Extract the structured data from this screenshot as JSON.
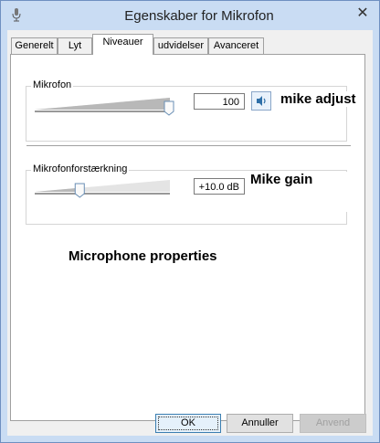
{
  "window": {
    "title": "Egenskaber for Mikrofon",
    "close_glyph": "✕",
    "icon": "microphone-icon"
  },
  "tabs": [
    {
      "label": "Generelt",
      "active": false
    },
    {
      "label": "Lyt",
      "active": false
    },
    {
      "label": "Niveauer",
      "active": true
    },
    {
      "label": "udvidelser",
      "active": false
    },
    {
      "label": "Avanceret",
      "active": false
    }
  ],
  "microphone_group": {
    "label": "Mikrofon",
    "slider_level": 1.0,
    "value": "100",
    "mute_icon": "speaker-icon",
    "annotation": "mike adjust"
  },
  "boost_group": {
    "label": "Mikrofonforstærkning",
    "slider_level": 0.333,
    "value": "+10.0 dB",
    "annotation": "Mike gain"
  },
  "caption": "Microphone properties",
  "buttons": {
    "ok": "OK",
    "cancel": "Annuller",
    "apply": "Anvend"
  },
  "colors": {
    "title_bg": "#c9dcf3",
    "client_bg": "#f0f0f0",
    "panel_bg": "#ffffff",
    "accent": "#3c7fb1"
  }
}
